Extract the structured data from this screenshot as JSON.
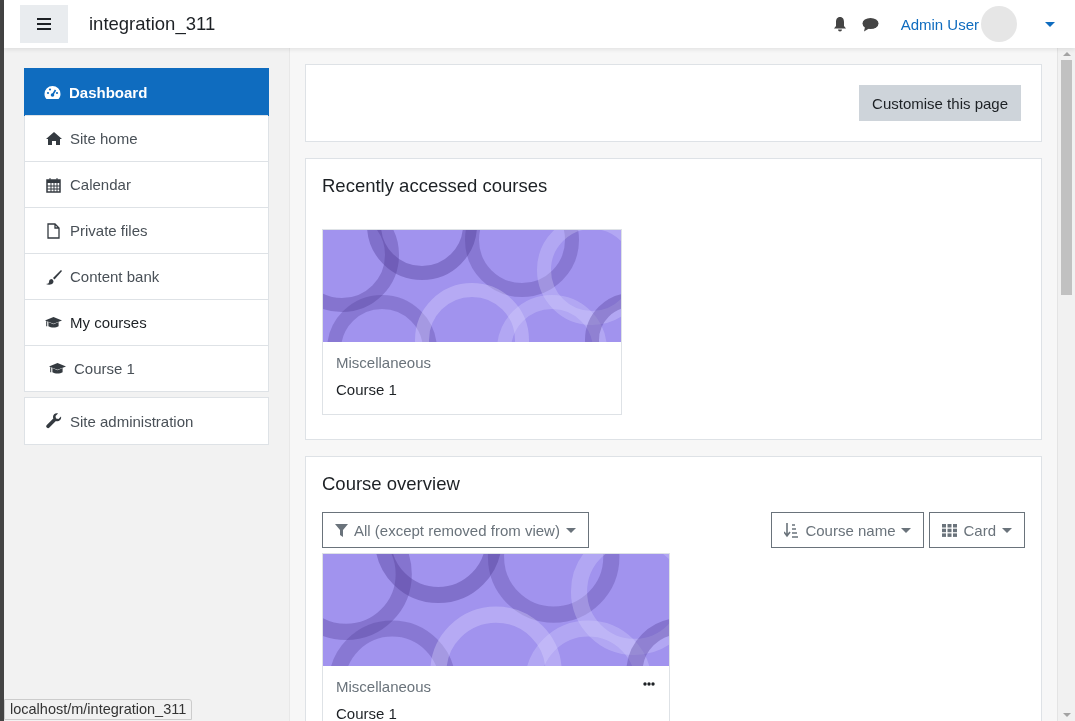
{
  "navbar": {
    "site_name": "integration_311",
    "user_name": "Admin User"
  },
  "sidebar": {
    "groups": [
      {
        "items": [
          {
            "label": "Dashboard",
            "kind": "dashboard",
            "selected": true
          },
          {
            "label": "Site home",
            "kind": "home",
            "selected": false
          },
          {
            "label": "Calendar",
            "kind": "calendar",
            "selected": false
          },
          {
            "label": "Private files",
            "kind": "file",
            "selected": false
          },
          {
            "label": "Content bank",
            "kind": "brush",
            "selected": false
          },
          {
            "label": "My courses",
            "kind": "courses",
            "selected": false,
            "children": [
              {
                "label": "Course 1",
                "kind": "course",
                "selected": false
              }
            ]
          }
        ]
      },
      {
        "items": [
          {
            "label": "Site administration",
            "kind": "admin",
            "selected": false
          }
        ]
      }
    ]
  },
  "page_header": {
    "button": "Customise this page"
  },
  "recent": {
    "title": "Recently accessed courses",
    "courses": [
      {
        "category": "Miscellaneous",
        "name": "Course 1"
      }
    ]
  },
  "overview": {
    "title": "Course overview",
    "filter": "All (except removed from view)",
    "sort": "Course name",
    "view": "Card",
    "courses": [
      {
        "category": "Miscellaneous",
        "name": "Course 1"
      }
    ]
  },
  "status_url": "localhost/m/integration_311"
}
